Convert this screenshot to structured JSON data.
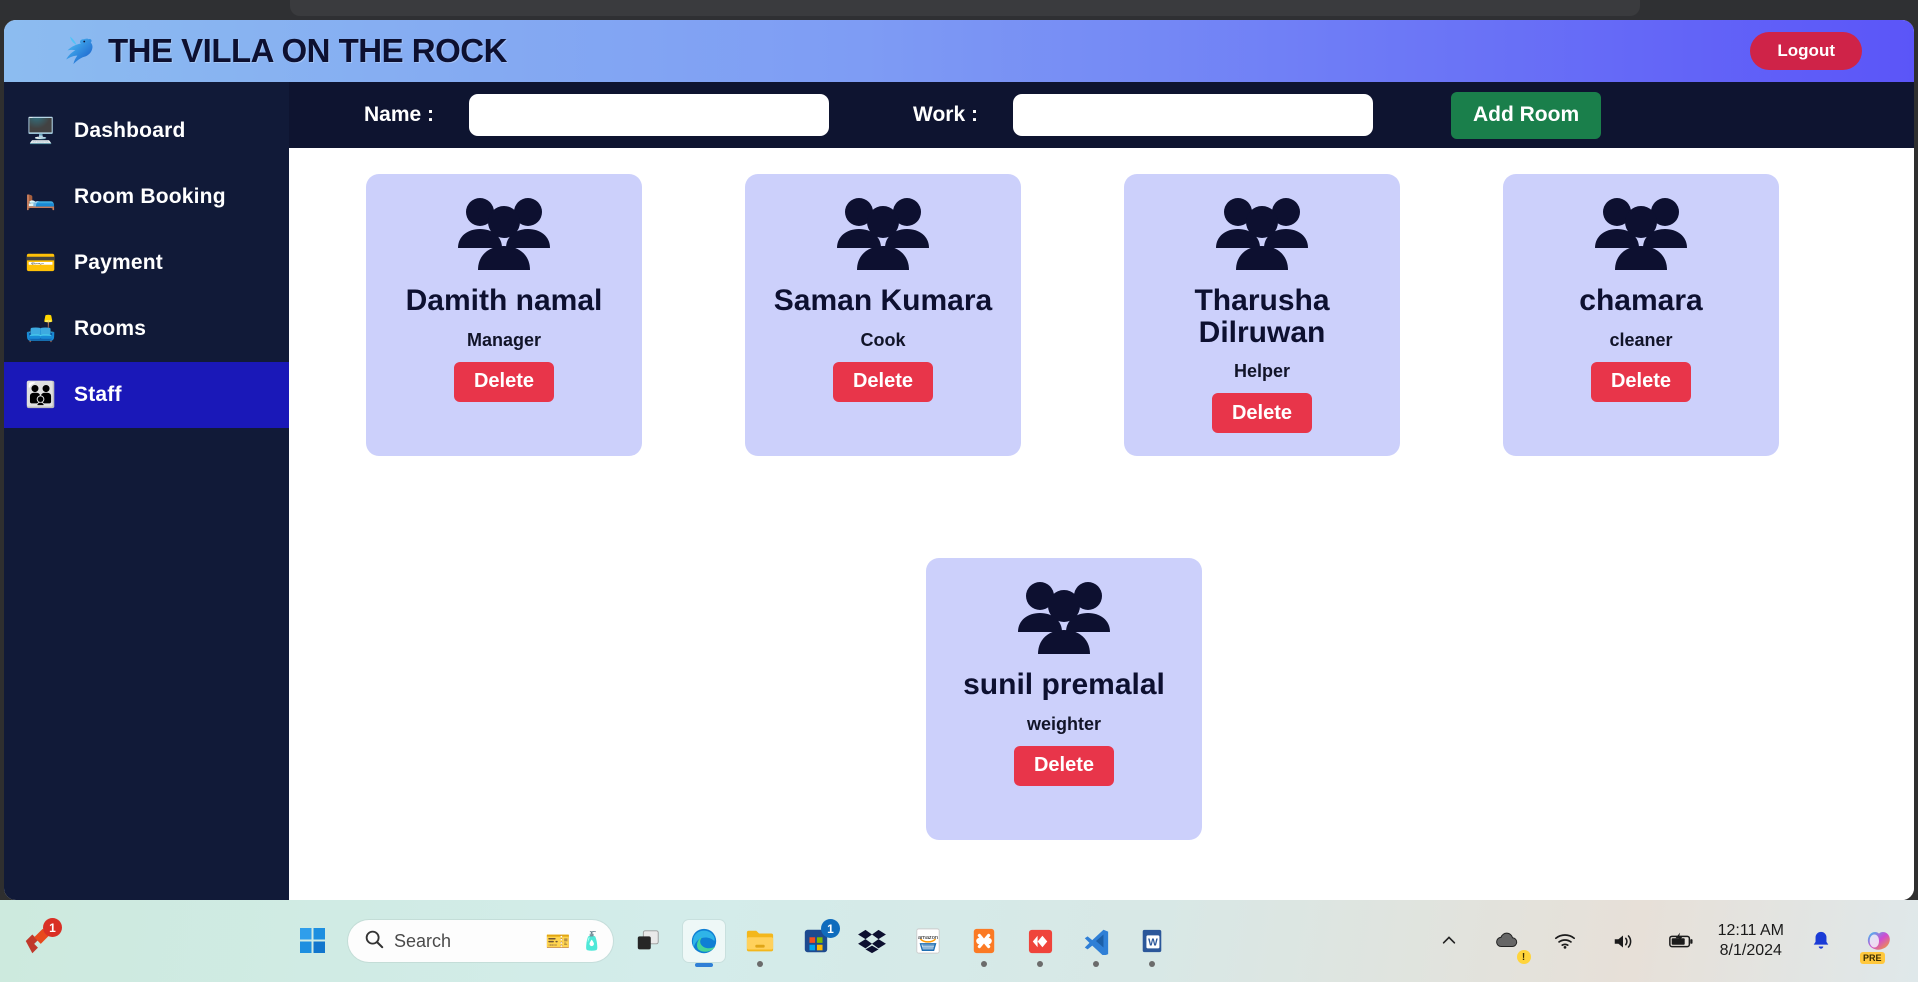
{
  "header": {
    "logo_icon": "bird-logo-icon",
    "title": "THE VILLA ON THE ROCK",
    "logout_label": "Logout"
  },
  "sidebar": {
    "items": [
      {
        "label": "Dashboard",
        "icon": "dashboard-icon",
        "glyph": "🖥️",
        "active": false
      },
      {
        "label": "Room Booking",
        "icon": "bed-icon",
        "glyph": "🛏️",
        "active": false
      },
      {
        "label": "Payment",
        "icon": "wallet-icon",
        "glyph": "💳",
        "active": false
      },
      {
        "label": "Rooms",
        "icon": "hotel-room-icon",
        "glyph": "🛋️",
        "active": false
      },
      {
        "label": "Staff",
        "icon": "people-group-icon",
        "glyph": "👪",
        "active": true
      }
    ]
  },
  "toolbar": {
    "name_label": "Name :",
    "name_value": "",
    "name_placeholder": "",
    "work_label": "Work :",
    "work_value": "",
    "work_placeholder": "",
    "add_room_label": "Add Room"
  },
  "staff": {
    "delete_label": "Delete",
    "card_icon": "people-group-icon",
    "row1": [
      {
        "name": "Damith namal",
        "role": "Manager"
      },
      {
        "name": "Saman Kumara",
        "role": "Cook"
      },
      {
        "name": "Tharusha Dilruwan",
        "role": "Helper"
      },
      {
        "name": "chamara",
        "role": "cleaner"
      }
    ],
    "row2": [
      {
        "name": "sunil premalal",
        "role": "weighter"
      }
    ]
  },
  "taskbar": {
    "search_placeholder": "Search",
    "search_icon": "search-icon",
    "start_icon": "windows-start-icon",
    "notification_badge": "1",
    "store_badge": "1",
    "apps": [
      {
        "name": "task-view-icon",
        "glyph": "❑",
        "running": false
      },
      {
        "name": "microsoft-edge-icon",
        "glyph": "",
        "running": true
      },
      {
        "name": "file-explorer-icon",
        "glyph": "📁",
        "running": true
      },
      {
        "name": "microsoft-store-icon",
        "glyph": "",
        "running": false
      },
      {
        "name": "dropbox-icon",
        "glyph": "",
        "running": false
      },
      {
        "name": "amazon-icon",
        "glyph": "",
        "running": false
      },
      {
        "name": "xampp-icon",
        "glyph": "",
        "running": true
      },
      {
        "name": "anydesk-icon",
        "glyph": "",
        "running": true
      },
      {
        "name": "vscode-icon",
        "glyph": "",
        "running": true
      },
      {
        "name": "microsoft-word-icon",
        "glyph": "",
        "running": true
      }
    ],
    "tray": {
      "chevron_icon": "chevron-up-icon",
      "onedrive_icon": "onedrive-warning-icon",
      "wifi_icon": "wifi-icon",
      "volume_icon": "volume-icon",
      "battery_icon": "battery-charging-icon",
      "time": "12:11 AM",
      "date": "8/1/2024",
      "bell_icon": "notification-bell-icon",
      "copilot_icon": "copilot-icon",
      "copilot_badge": "PRE"
    }
  },
  "colors": {
    "sidebar_bg": "#111a38",
    "active_nav": "#1a18b8",
    "toolbar_bg": "#0e1430",
    "card_bg": "#ccd0fb",
    "delete_red": "#e8354a",
    "logout_red": "#cf2348",
    "add_green": "#1a7f4b"
  }
}
